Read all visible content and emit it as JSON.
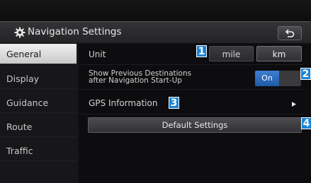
{
  "header": {
    "title": "Navigation Settings",
    "back_icon": "back-arrow-icon",
    "settings_icon": "gear-icon"
  },
  "sidebar": {
    "items": [
      {
        "label": "General",
        "selected": true
      },
      {
        "label": "Display",
        "selected": false
      },
      {
        "label": "Guidance",
        "selected": false
      },
      {
        "label": "Route",
        "selected": false
      },
      {
        "label": "Traffic",
        "selected": false
      }
    ]
  },
  "settings": {
    "unit": {
      "label": "Unit",
      "options": [
        "mile",
        "km"
      ],
      "selected": "km",
      "badge": "1"
    },
    "show_previous": {
      "label_line1": "Show Previous Destinations",
      "label_line2": "after Navigation Start-Up",
      "toggle_label": "On",
      "state": "on",
      "badge": "2"
    },
    "gps": {
      "label": "GPS Information",
      "badge": "3"
    },
    "default": {
      "label": "Default Settings",
      "badge": "4"
    }
  },
  "colors": {
    "accent": "#1f5aa6",
    "badge": "#1a84d8",
    "selected_tab": "#e0e0e0"
  }
}
